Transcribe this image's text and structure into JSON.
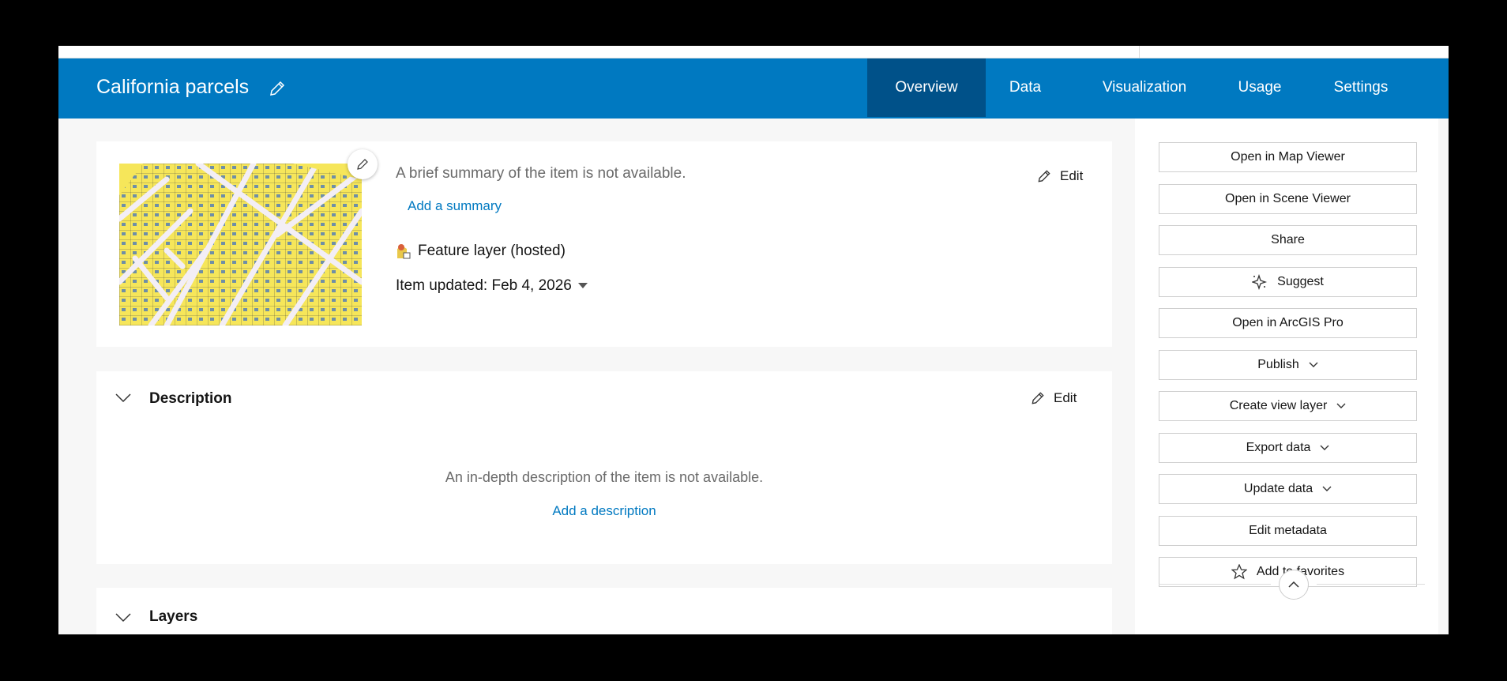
{
  "header": {
    "title": "California parcels",
    "tabs": [
      {
        "label": "Overview",
        "active": true
      },
      {
        "label": "Data"
      },
      {
        "label": "Visualization"
      },
      {
        "label": "Usage"
      },
      {
        "label": "Settings"
      }
    ],
    "color": "#0079c1",
    "active_color": "#005189"
  },
  "overview": {
    "summary": "A brief summary of the item is not available.",
    "add_summary": "Add a summary",
    "edit": "Edit",
    "item_type": "Feature layer (hosted)",
    "item_updated": "Item updated: Feb 4, 2026"
  },
  "description": {
    "title": "Description",
    "edit": "Edit",
    "empty": "An in-depth description of the item is not available.",
    "add": "Add a description"
  },
  "layers": {
    "title": "Layers"
  },
  "sidebar": {
    "buttons": [
      {
        "label": "Open in Map Viewer"
      },
      {
        "label": "Open in Scene Viewer"
      },
      {
        "label": "Share"
      },
      {
        "label": "Suggest",
        "icon": "sparkle-icon"
      },
      {
        "label": "Open in ArcGIS Pro"
      },
      {
        "label": "Publish",
        "dropdown": true
      },
      {
        "label": "Create view layer",
        "dropdown": true
      },
      {
        "label": "Export data",
        "dropdown": true
      },
      {
        "label": "Update data",
        "dropdown": true
      },
      {
        "label": "Edit metadata"
      },
      {
        "label": "Add to favorites",
        "icon": "star-icon"
      }
    ]
  }
}
